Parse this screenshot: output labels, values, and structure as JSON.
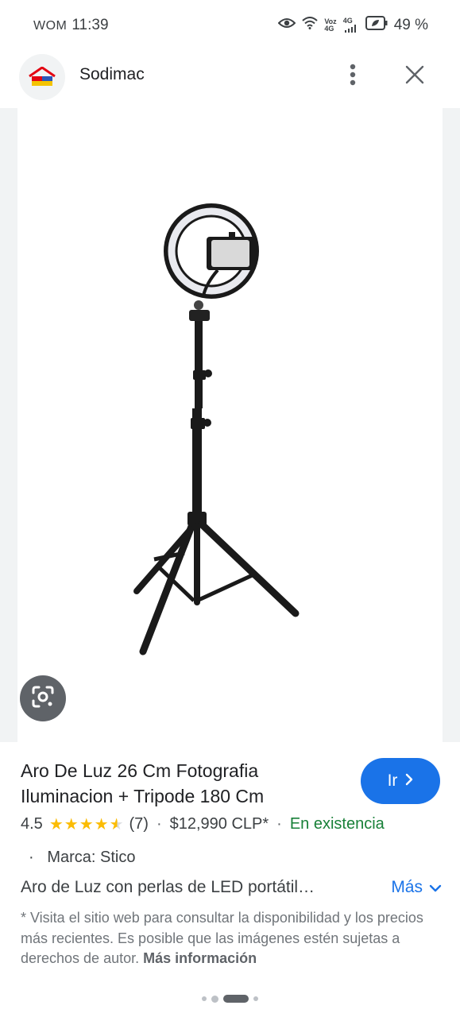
{
  "status_bar": {
    "carrier": "WOM",
    "time": "11:39",
    "voz": "Voz",
    "net_top": "4G",
    "net_bottom": "4G",
    "battery": "49 %"
  },
  "app_bar": {
    "title": "Sodimac",
    "icons": [
      "sodimac-logo",
      "more-vert-icon",
      "close-icon"
    ]
  },
  "product": {
    "title": "Aro De Luz 26 Cm Fotografia Iluminacion + Tripode 180 Cm",
    "go_label": "Ir",
    "rating": "4.5",
    "rating_value": 4.5,
    "stars": "★★★★★",
    "reviews": "(7)",
    "price": "$12,990 CLP*",
    "availability": "En existencia",
    "brand": "Marca: Stico",
    "description": "Aro de Luz con perlas de LED portátil…",
    "more_label": "Más",
    "disclaimer": "* Visita el sitio web para consultar la disponibilidad y los precios más recientes. Es posible que las imágenes estén sujetas a derechos de autor.",
    "more_info_label": "Más información"
  },
  "pager": {
    "count": 4,
    "active_index": 2
  },
  "colors": {
    "accent": "#1a73e8",
    "in_stock": "#188038",
    "stars": "#fbbc04"
  }
}
